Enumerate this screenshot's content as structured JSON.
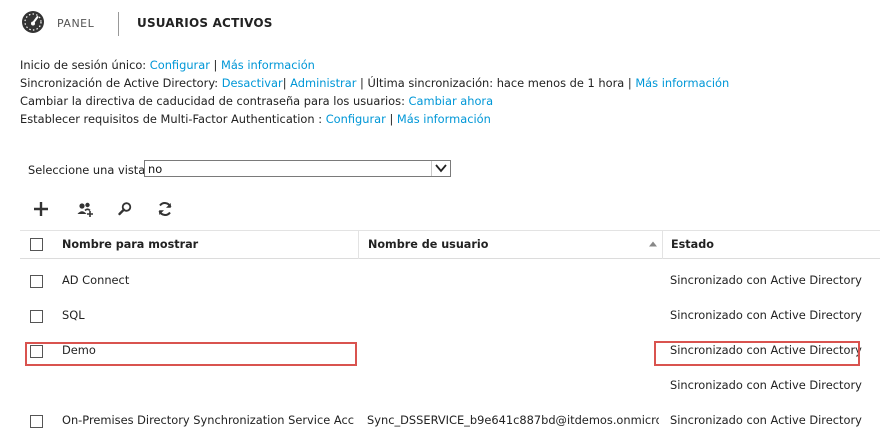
{
  "header": {
    "icon": "dashboard-gauge-icon",
    "nav_panel": "PANEL",
    "title": "USUARIOS ACTIVOS"
  },
  "info": {
    "sso_label": "Inicio de sesión único:",
    "sso_configure": "Configurar",
    "sso_more": "Más información",
    "ad_label": "Sincronización de Active Directory:",
    "ad_deactivate": "Desactivar",
    "ad_manage": "Administrar",
    "ad_last_sync": "Última sincronización: hace menos de 1 hora",
    "ad_more": "Más información",
    "pwd_label": "Cambiar la directiva de caducidad de contraseña para los usuarios:",
    "pwd_change": "Cambiar ahora",
    "mfa_label": "Establecer requisitos de Multi-Factor Authentication :",
    "mfa_configure": "Configurar",
    "mfa_more": "Más información",
    "separator": "|"
  },
  "view": {
    "label": "Seleccione una vista:",
    "selected": "no"
  },
  "toolbar": {
    "icons": [
      "add-icon",
      "add-users-icon",
      "search-icon",
      "refresh-icon"
    ]
  },
  "table": {
    "columns": [
      "Nombre para mostrar",
      "Nombre de usuario",
      "Estado"
    ],
    "rows": [
      {
        "name": "AD Connect",
        "username": "",
        "status": "Sincronizado con Active Directory"
      },
      {
        "name": "SQL",
        "username": "",
        "status": "Sincronizado con Active Directory"
      },
      {
        "name": "Demo",
        "username": "",
        "status": "Sincronizado con Active Directory"
      },
      {
        "name": "",
        "username": "",
        "status": "Sincronizado con Active Directory"
      },
      {
        "name": "On-Premises Directory Synchronization Service Acc...",
        "username": "Sync_DSSERVICE_b9e641c887bd@itdemos.onmicro...",
        "status": "Sincronizado con Active Directory"
      }
    ]
  },
  "colors": {
    "link": "#0097d7",
    "highlight": "#d9534f"
  }
}
